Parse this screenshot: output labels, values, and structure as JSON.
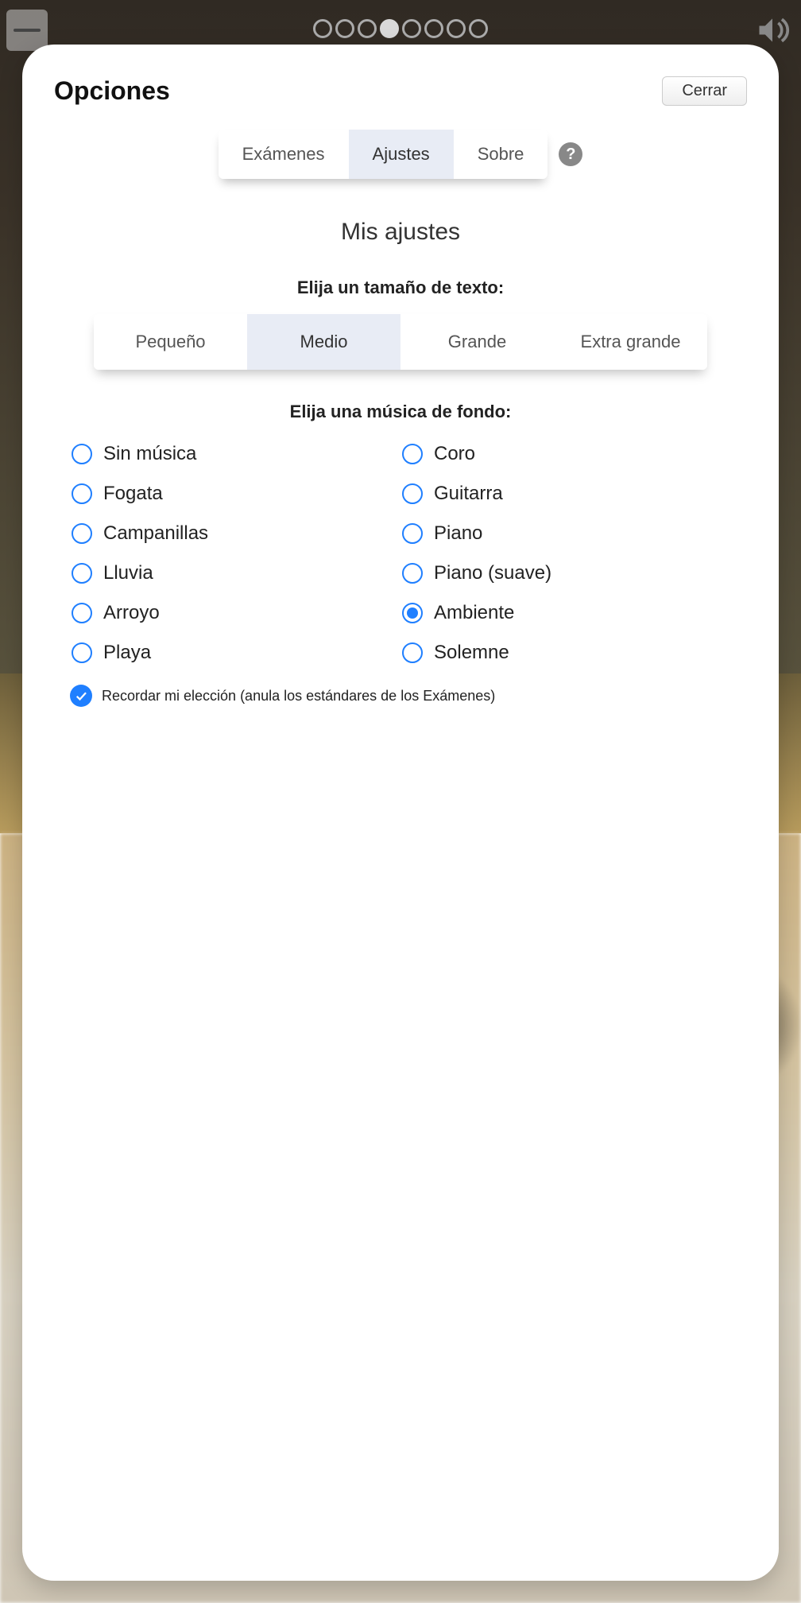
{
  "header": {
    "title": "Opciones",
    "close_label": "Cerrar"
  },
  "pager": {
    "count": 8,
    "active_index": 3
  },
  "tabs": {
    "items": [
      {
        "label": "Exámenes"
      },
      {
        "label": "Ajustes"
      },
      {
        "label": "Sobre"
      }
    ],
    "active_index": 1
  },
  "section": {
    "title": "Mis ajustes"
  },
  "text_size": {
    "label": "Elija un tamaño de texto:",
    "options": [
      {
        "label": "Pequeño"
      },
      {
        "label": "Medio"
      },
      {
        "label": "Grande"
      },
      {
        "label": "Extra grande"
      }
    ],
    "active_index": 1
  },
  "music": {
    "label": "Elija una música de fondo:",
    "options_left": [
      {
        "label": "Sin música"
      },
      {
        "label": "Fogata"
      },
      {
        "label": "Campanillas"
      },
      {
        "label": "Lluvia"
      },
      {
        "label": "Arroyo"
      },
      {
        "label": "Playa"
      }
    ],
    "options_right": [
      {
        "label": "Coro"
      },
      {
        "label": "Guitarra"
      },
      {
        "label": "Piano"
      },
      {
        "label": "Piano (suave)"
      },
      {
        "label": "Ambiente"
      },
      {
        "label": "Solemne"
      }
    ],
    "selected_column": "right",
    "selected_index": 4
  },
  "remember": {
    "label": "Recordar mi elección (anula los estándares de los Exámenes)",
    "checked": true
  }
}
